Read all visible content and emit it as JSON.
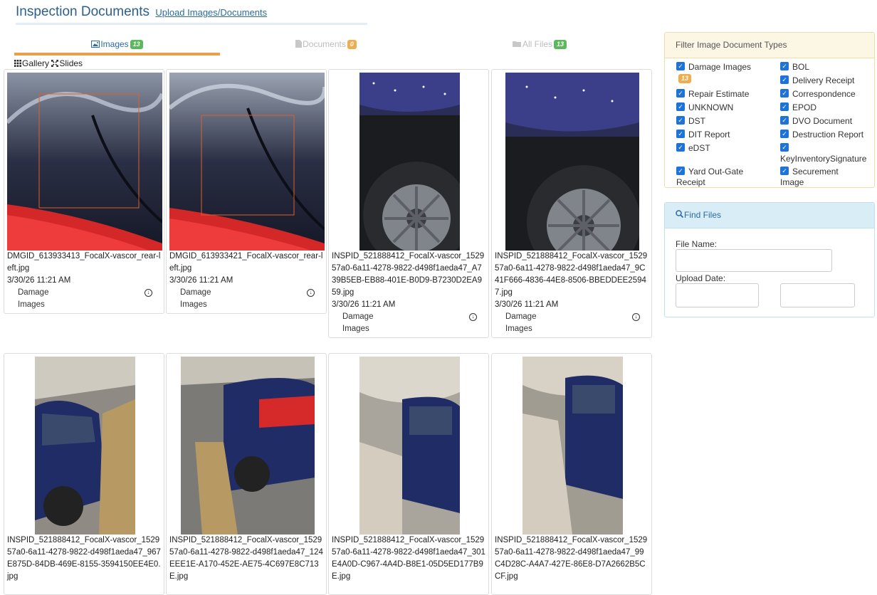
{
  "header": {
    "title": "Inspection Documents",
    "upload_link": "Upload Images/Documents"
  },
  "tabs": [
    {
      "label": "Images",
      "count": "13"
    },
    {
      "label": "Documents",
      "count": "0"
    },
    {
      "label": "All Files",
      "count": "13"
    }
  ],
  "view": {
    "gallery": "Gallery",
    "slides": "Slides"
  },
  "cards": [
    {
      "name": "DMGID_613933413_FocalX-vascor_rear-left.jpg",
      "date": "3/30/26 11:21 AM",
      "type": "Damage Images"
    },
    {
      "name": "DMGID_613933421_FocalX-vascor_rear-left.jpg",
      "date": "3/30/26 11:21 AM",
      "type": "Damage Images"
    },
    {
      "name": "INSPID_521888412_FocalX-vascor_152957a0-6a11-4278-9822-d498f1aeda47_A739B5EB-EB88-401E-B0D9-B7230D2EA959.jpg",
      "date": "3/30/26 11:21 AM",
      "type": "Damage Images"
    },
    {
      "name": "INSPID_521888412_FocalX-vascor_152957a0-6a11-4278-9822-d498f1aeda47_9C41F666-4836-44E8-8506-BBEDDEE25947.jpg",
      "date": "3/30/26 11:21 AM",
      "type": "Damage Images"
    },
    {
      "name": "INSPID_521888412_FocalX-vascor_152957a0-6a11-4278-9822-d498f1aeda47_967E875D-84DB-469E-8155-3594150EE4E0.jpg"
    },
    {
      "name": "INSPID_521888412_FocalX-vascor_152957a0-6a11-4278-9822-d498f1aeda47_124EEE1E-A170-452E-AE75-4C697E8C713E.jpg"
    },
    {
      "name": "INSPID_521888412_FocalX-vascor_152957a0-6a11-4278-9822-d498f1aeda47_301E4A0D-C967-4A4D-B8E1-05D5ED177B9E.jpg"
    },
    {
      "name": "INSPID_521888412_FocalX-vascor_152957a0-6a11-4278-9822-d498f1aeda47_99C4D28C-A4A7-427E-86E8-D7A2662B5CCF.jpg"
    }
  ],
  "filter": {
    "title": "Filter Image Document Types",
    "damage_count": "13",
    "left": [
      "Damage Images",
      "Repair Estimate",
      "UNKNOWN",
      "DST",
      "DIT Report",
      "eDST",
      "Yard Out-Gate Receipt"
    ],
    "right": [
      "BOL",
      "Delivery Receipt",
      "Correspondence",
      "EPOD",
      "DVO Document",
      "Destruction Report",
      "KeyInventorySignature",
      "Securement Image"
    ]
  },
  "find": {
    "title": "Find Files",
    "file_name_label": "File Name:",
    "upload_date_label": "Upload Date:"
  }
}
